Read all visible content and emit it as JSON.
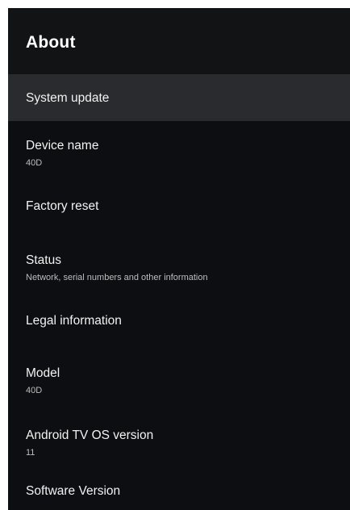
{
  "header": {
    "title": "About"
  },
  "items": [
    {
      "label": "System update",
      "sub": ""
    },
    {
      "label": "Device name",
      "sub": "40D"
    },
    {
      "label": "Factory reset",
      "sub": ""
    },
    {
      "label": "Status",
      "sub": "Network, serial numbers and other information"
    },
    {
      "label": "Legal information",
      "sub": ""
    },
    {
      "label": "Model",
      "sub": "40D"
    },
    {
      "label": "Android TV OS version",
      "sub": "11"
    },
    {
      "label": "Software Version",
      "sub": ""
    }
  ],
  "colors": {
    "background": "#0d0e11",
    "focused_row": "#2a2b2e",
    "header": "#121315"
  }
}
